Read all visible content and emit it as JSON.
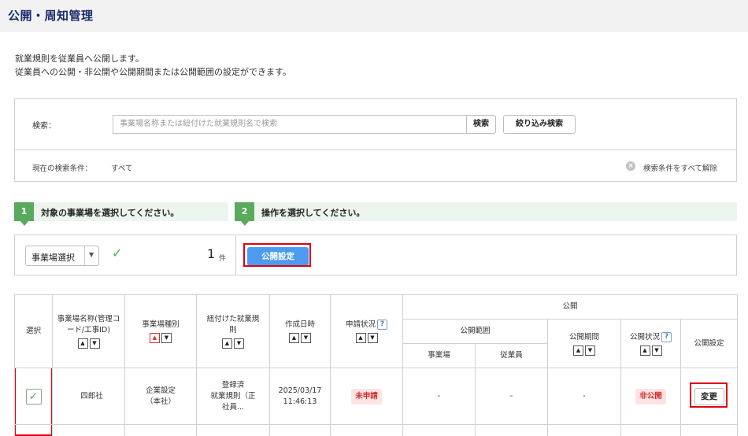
{
  "header": {
    "title": "公開・周知管理"
  },
  "description": {
    "line1": "就業規則を従業員へ公開します。",
    "line2": "従業員への公開・非公開や公開期間または公開範囲の設定ができます。"
  },
  "search": {
    "label": "検索：",
    "placeholder": "事業場名称または紐付けた就業規則名で検索",
    "search_button": "検索",
    "narrow_button": "絞り込み検索",
    "condition_label": "現在の検索条件：",
    "condition_value": "すべて",
    "clear_all": "検索条件をすべて解除"
  },
  "steps": [
    {
      "num": "1",
      "text": "対象の事業場を選択してください。"
    },
    {
      "num": "2",
      "text": "操作を選択してください。"
    }
  ],
  "operation": {
    "select_value": "事業場選択",
    "count": "1",
    "count_unit": "件",
    "publish_button": "公開設定"
  },
  "table": {
    "headers": {
      "select": "選択",
      "name": "事業場名称(管理コード/工事ID)",
      "type": "事業場種別",
      "rules": "紐付けた就業規則",
      "created": "作成日時",
      "apply_status": "申請状況",
      "publish": "公開",
      "scope": "公開範囲",
      "site": "事業場",
      "employee": "従業員",
      "period": "公開期間",
      "pub_status": "公開状況",
      "pub_setting": "公開設定"
    },
    "row": {
      "name": "四郎社",
      "type_line1": "企業設定",
      "type_line2": "（本社）",
      "rules_line1": "登録済",
      "rules_line2": "就業規則（正",
      "rules_line3": "社員...",
      "date": "2025/03/17",
      "time": "11:46:13",
      "apply_status": "未申請",
      "site": "-",
      "employee": "-",
      "period": "-",
      "pub_status": "非公開",
      "change_button": "変更"
    }
  },
  "icons": {
    "help": "?",
    "sort_up": "▲",
    "sort_down": "▼",
    "check": "✓",
    "clear": "×",
    "dropdown": "▼"
  },
  "colors": {
    "accent_blue": "#4d9bf0",
    "step_green": "#5aaa5e",
    "highlight_red": "#e00012",
    "status_red": "#d32f2f",
    "title_navy": "#1a2a6c"
  }
}
